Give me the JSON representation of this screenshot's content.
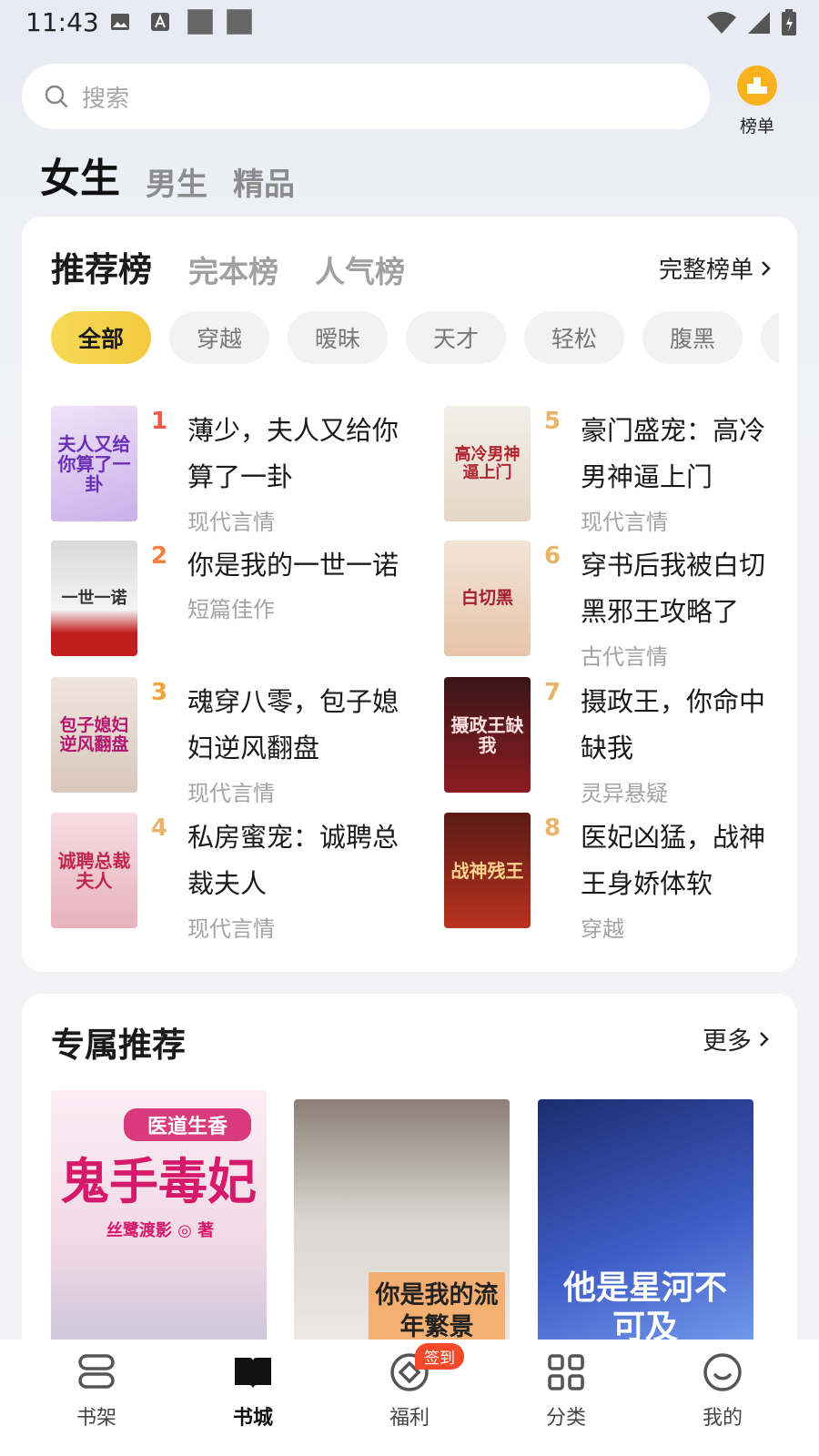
{
  "status_bar": {
    "time": "11:43"
  },
  "search": {
    "placeholder": "搜索"
  },
  "rank_entry": {
    "label": "榜单",
    "color": "#f7b21e"
  },
  "gender_tabs": [
    {
      "label": "女生",
      "active": true
    },
    {
      "label": "男生",
      "active": false
    },
    {
      "label": "精品",
      "active": false
    }
  ],
  "ranking": {
    "tabs": [
      {
        "label": "推荐榜",
        "active": true
      },
      {
        "label": "完本榜",
        "active": false
      },
      {
        "label": "人气榜",
        "active": false
      }
    ],
    "full_list_label": "完整榜单",
    "chips": [
      {
        "label": "全部",
        "active": true
      },
      {
        "label": "穿越",
        "active": false
      },
      {
        "label": "暧昧",
        "active": false
      },
      {
        "label": "天才",
        "active": false
      },
      {
        "label": "轻松",
        "active": false
      },
      {
        "label": "腹黑",
        "active": false
      }
    ],
    "books": [
      {
        "rank": "1",
        "title": "薄少，夫人又给你算了一卦",
        "category": "现代言情",
        "cover_text": "夫人又给你算了一卦"
      },
      {
        "rank": "2",
        "title": "你是我的一世一诺",
        "category": "短篇佳作",
        "cover_text": "一世一诺"
      },
      {
        "rank": "3",
        "title": "魂穿八零，包子媳妇逆风翻盘",
        "category": "现代言情",
        "cover_text": "包子媳妇逆风翻盘"
      },
      {
        "rank": "4",
        "title": "私房蜜宠：诚聘总裁夫人",
        "category": "现代言情",
        "cover_text": "诚聘总裁夫人"
      },
      {
        "rank": "5",
        "title": "豪门盛宠：高冷男神逼上门",
        "category": "现代言情",
        "cover_text": "高冷男神逼上门"
      },
      {
        "rank": "6",
        "title": "穿书后我被白切黑邪王攻略了",
        "category": "古代言情",
        "cover_text": "白切黑"
      },
      {
        "rank": "7",
        "title": "摄政王，你命中缺我",
        "category": "灵异悬疑",
        "cover_text": "摄政王缺我"
      },
      {
        "rank": "8",
        "title": "医妃凶猛，战神王身娇体软",
        "category": "穿越",
        "cover_text": "战神残王"
      }
    ],
    "rank_colors": [
      "#f05a4a",
      "#f5803f",
      "#f3a33a",
      "#e8b46a",
      "#e8b46a",
      "#e8b46a",
      "#e8b46a",
      "#e8b46a"
    ]
  },
  "exclusive": {
    "title": "专属推荐",
    "more_label": "更多",
    "books": [
      {
        "cover_text": "鬼手毒妃",
        "sub_text": "医道生香",
        "author_text": "丝鹭渡影 ◎ 著"
      },
      {
        "cover_text": "你是我的流年繁景"
      },
      {
        "cover_text": "他是星河不可及"
      }
    ]
  },
  "bottom_nav": [
    {
      "label": "书架",
      "icon": "bookshelf-icon",
      "active": false
    },
    {
      "label": "书城",
      "icon": "book-open-icon",
      "active": true
    },
    {
      "label": "福利",
      "icon": "coin-icon",
      "active": false,
      "badge": "签到"
    },
    {
      "label": "分类",
      "icon": "grid-icon",
      "active": false
    },
    {
      "label": "我的",
      "icon": "smile-icon",
      "active": false
    }
  ]
}
